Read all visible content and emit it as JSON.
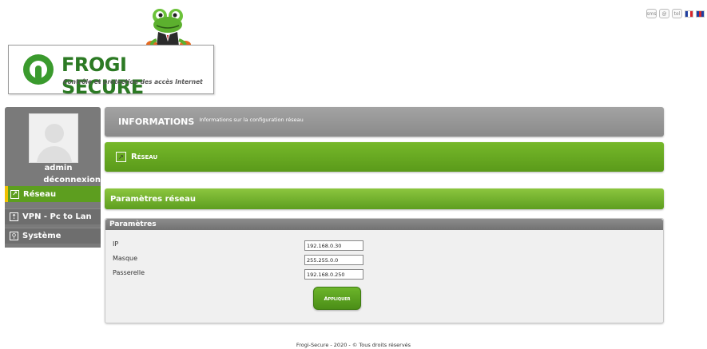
{
  "top_icons": [
    {
      "label": "sms",
      "name": "sms-icon"
    },
    {
      "label": "@",
      "name": "email-icon"
    },
    {
      "label": "tel",
      "name": "phone-icon"
    }
  ],
  "languages": [
    {
      "name": "flag-fr-icon",
      "colors": [
        "#1f3fa0",
        "#ffffff",
        "#d8262b"
      ]
    },
    {
      "name": "flag-uk-icon",
      "colors": [
        "#1f3fa0",
        "#d8262b",
        "#1f3fa0"
      ]
    }
  ],
  "logo": {
    "title": "FROGI SECURE",
    "subtitle": "Contrôle et protection des accès Internet",
    "brand_color": "#2c7a24"
  },
  "sidebar": {
    "user_name": "admin",
    "logout": "déconnexion",
    "items": [
      {
        "label": "Réseau",
        "icon": "chart-line-icon",
        "active": true
      },
      {
        "label": "VPN - Pc to Lan",
        "icon": "upload-icon",
        "active": false
      },
      {
        "label": "Système",
        "icon": "search-icon",
        "active": false
      }
    ]
  },
  "info": {
    "title": "INFORMATIONS",
    "description": "Informations sur la configuration réseau"
  },
  "section": {
    "title": "Réseau",
    "subtitle": "Paramètres réseau"
  },
  "panel": {
    "title": "Paramètres",
    "fields": [
      {
        "label": "IP",
        "value": "192.168.0.30"
      },
      {
        "label": "Masque",
        "value": "255.255.0.0"
      },
      {
        "label": "Passerelle",
        "value": "192.168.0.250"
      }
    ],
    "apply_label": "Appliquer"
  },
  "colors": {
    "accent_green": "#5d9e1f",
    "active_marker": "#f0c000",
    "header_grey": "#8a8a8a"
  },
  "footer": "Frogi-Secure - 2020 - © Tous droits réservés"
}
